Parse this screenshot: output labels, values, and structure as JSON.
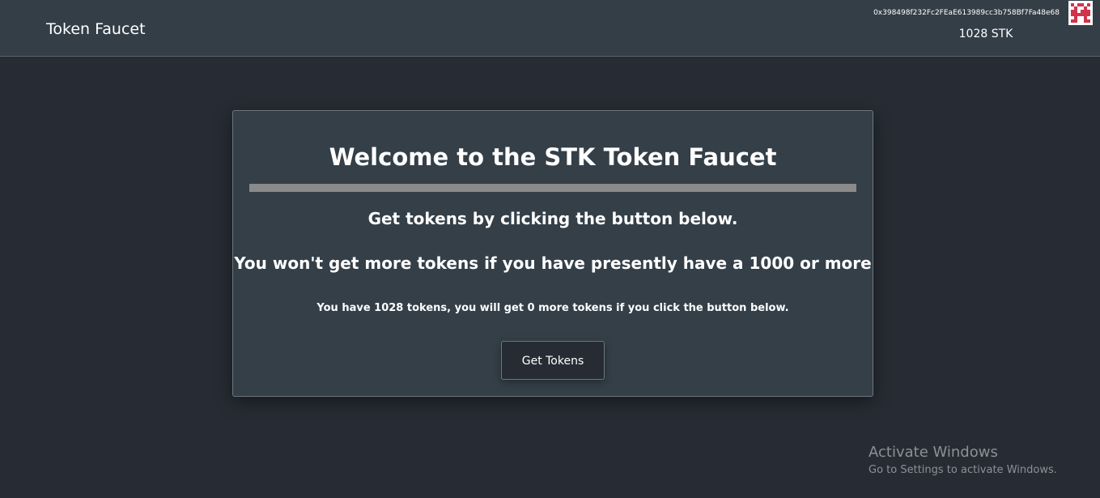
{
  "navbar": {
    "brand": "Token Faucet",
    "account_address": "0x398498f232Fc2FEaE613989cc3b758Bf7Fa48e68",
    "balance": "1028 STK",
    "avatar_colors": {
      "primary": "#d0344a",
      "background": "#ffffff"
    }
  },
  "card": {
    "title": "Welcome to the STK Token Faucet",
    "line1": "Get tokens by clicking the button below.",
    "line2": "You won't get more tokens if you have presently have a 1000 or more",
    "line3": "You have 1028 tokens, you will get 0 more tokens if you click the button below.",
    "button_label": "Get Tokens"
  },
  "watermark": {
    "title": "Activate Windows",
    "subtitle": "Go to Settings to activate Windows."
  },
  "colors": {
    "page_background": "#272c34",
    "navbar_background": "#343e47",
    "card_background": "#343f48",
    "divider": "#8a8a8a"
  }
}
